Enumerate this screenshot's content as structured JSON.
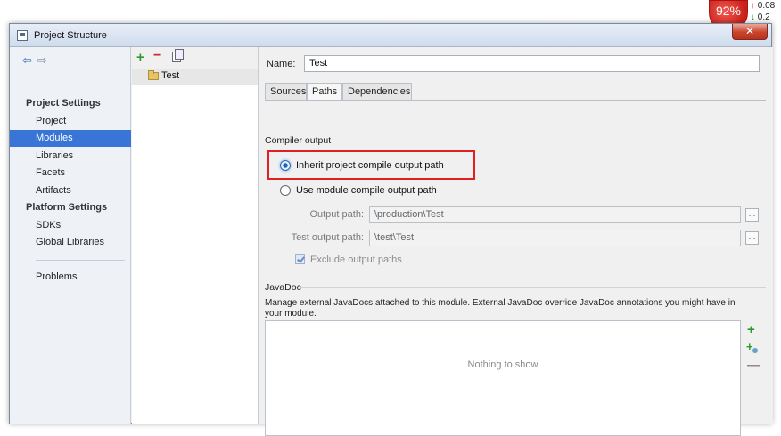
{
  "window": {
    "title": "Project Structure",
    "close_label": "✕"
  },
  "net_monitor": {
    "percent": "92%",
    "up_value": "0.08",
    "down_value": "0.2",
    "up_arrow": "↑",
    "down_arrow": "↓"
  },
  "nav": {
    "back_icon": "⇦",
    "forward_icon": "⇨",
    "project_settings_header": "Project Settings",
    "project_items": [
      "Project",
      "Modules",
      "Libraries",
      "Facets",
      "Artifacts"
    ],
    "platform_settings_header": "Platform Settings",
    "platform_items": [
      "SDKs",
      "Global Libraries"
    ],
    "problems": "Problems",
    "selected": "Modules"
  },
  "modules_panel": {
    "add_icon": "+",
    "remove_icon": "−",
    "module_name": "Test"
  },
  "content": {
    "name_label": "Name:",
    "name_value": "Test",
    "tabs": [
      "Sources",
      "Paths",
      "Dependencies"
    ],
    "active_tab": "Paths",
    "compiler_output": {
      "title": "Compiler output",
      "inherit_label": "Inherit project compile output path",
      "use_module_label": "Use module compile output path",
      "output_path_label": "Output path:",
      "output_path_value": "\\production\\Test",
      "test_output_label": "Test output path:",
      "test_output_value": "\\test\\Test",
      "browse_label": "...",
      "exclude_label": "Exclude output paths"
    },
    "javadoc": {
      "title": "JavaDoc",
      "description": "Manage external JavaDocs attached to this module. External JavaDoc override JavaDoc annotations you might have in your module.",
      "empty": "Nothing to show",
      "add_icon": "+",
      "remove_icon": "—"
    }
  }
}
